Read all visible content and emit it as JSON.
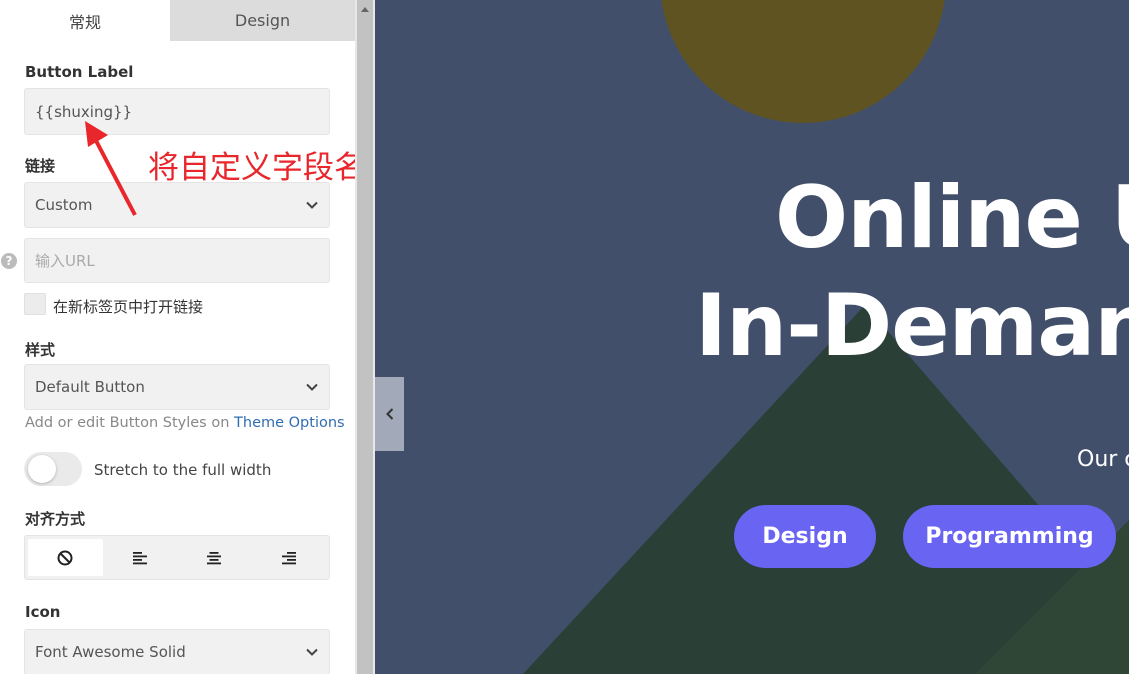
{
  "tabs": {
    "general": "常规",
    "design": "Design"
  },
  "button_label": {
    "label": "Button Label",
    "value": "{{shuxing}}"
  },
  "annotation": {
    "text": "将自定义字段名称填到这里",
    "color": "#e8262b"
  },
  "link": {
    "label": "链接",
    "type_value": "Custom",
    "url_placeholder": "输入URL",
    "new_tab_label": "在新标签页中打开链接"
  },
  "style": {
    "label": "样式",
    "value": "Default Button",
    "hint_prefix": "Add or edit Button Styles on ",
    "hint_link": "Theme Options"
  },
  "stretch": {
    "label": "Stretch to the full width",
    "enabled": false
  },
  "alignment": {
    "label": "对齐方式",
    "options": [
      "none-icon",
      "align-left-icon",
      "align-center-icon",
      "align-right-icon"
    ],
    "active": 0
  },
  "icon": {
    "label": "Icon",
    "value": "Font Awesome Solid"
  },
  "preview": {
    "hero_line1": "Online Ur",
    "hero_line2": "In-Demand",
    "subtitle": "Our c",
    "buttons": [
      "Design",
      "Programming"
    ],
    "colors": {
      "background": "#414f6b",
      "circle": "#5f5321",
      "mountain": "#2a3f35",
      "pill": "#6a64f2"
    }
  }
}
